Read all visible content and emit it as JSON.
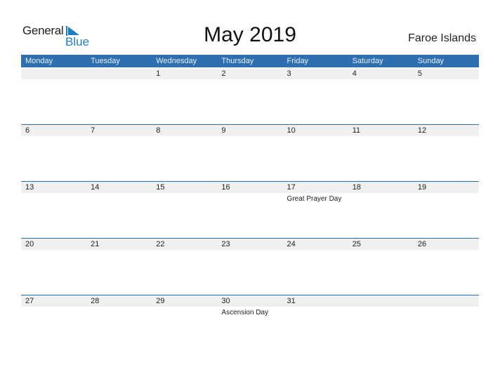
{
  "logo": {
    "line1": "General",
    "line2": "Blue"
  },
  "title": "May 2019",
  "country": "Faroe Islands",
  "colors": {
    "header_bg": "#2d6fb0",
    "accent": "#1f7ec9",
    "strip_bg": "#f0f0f0"
  },
  "days": [
    "Monday",
    "Tuesday",
    "Wednesday",
    "Thursday",
    "Friday",
    "Saturday",
    "Sunday"
  ],
  "weeks": [
    {
      "cells": [
        {
          "day": ""
        },
        {
          "day": ""
        },
        {
          "day": "1"
        },
        {
          "day": "2"
        },
        {
          "day": "3"
        },
        {
          "day": "4"
        },
        {
          "day": "5"
        }
      ]
    },
    {
      "cells": [
        {
          "day": "6"
        },
        {
          "day": "7"
        },
        {
          "day": "8"
        },
        {
          "day": "9"
        },
        {
          "day": "10"
        },
        {
          "day": "11"
        },
        {
          "day": "12"
        }
      ]
    },
    {
      "cells": [
        {
          "day": "13"
        },
        {
          "day": "14"
        },
        {
          "day": "15"
        },
        {
          "day": "16"
        },
        {
          "day": "17",
          "event": "Great Prayer Day"
        },
        {
          "day": "18"
        },
        {
          "day": "19"
        }
      ]
    },
    {
      "cells": [
        {
          "day": "20"
        },
        {
          "day": "21"
        },
        {
          "day": "22"
        },
        {
          "day": "23"
        },
        {
          "day": "24"
        },
        {
          "day": "25"
        },
        {
          "day": "26"
        }
      ]
    },
    {
      "cells": [
        {
          "day": "27"
        },
        {
          "day": "28"
        },
        {
          "day": "29"
        },
        {
          "day": "30",
          "event": "Ascension Day"
        },
        {
          "day": "31"
        },
        {
          "day": ""
        },
        {
          "day": ""
        }
      ]
    }
  ]
}
